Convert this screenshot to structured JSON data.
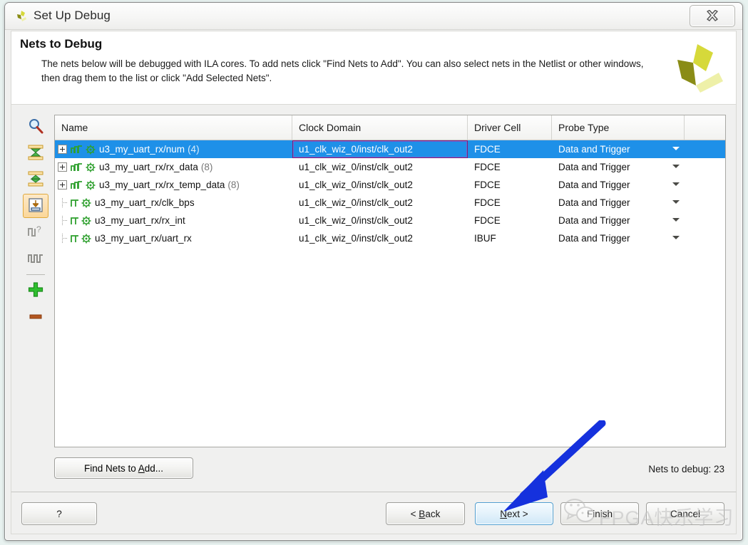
{
  "window": {
    "title": "Set Up Debug",
    "logo_icon": "xilinx-vivado-icon",
    "close_icon": "close-icon"
  },
  "header": {
    "title": "Nets to Debug",
    "description": "The nets below will be debugged with ILA cores. To add nets click \"Find Nets to Add\". You can also select nets in the Netlist or other windows, then drag them to the list or click \"Add Selected Nets\".",
    "brand_logo_icon": "xilinx-logo-icon"
  },
  "toolbar": {
    "items": [
      {
        "icon": "search-icon",
        "name": "find-nets-tool",
        "active": false
      },
      {
        "icon": "collapse-all-icon",
        "name": "collapse-all-tool",
        "active": false
      },
      {
        "icon": "expand-all-icon",
        "name": "expand-all-tool",
        "active": false
      },
      {
        "icon": "import-nets-icon",
        "name": "add-selected-nets-tool",
        "active": true
      },
      {
        "icon": "unknown-clock-icon",
        "name": "nets-unknown-clock-tool",
        "active": false
      },
      {
        "icon": "clock-waveform-icon",
        "name": "clock-domain-tool",
        "active": false
      },
      {
        "icon": "plus-icon",
        "name": "add-net-tool",
        "active": false
      },
      {
        "icon": "minus-icon",
        "name": "remove-net-tool",
        "active": false
      }
    ]
  },
  "table": {
    "columns": [
      {
        "key": "name",
        "label": "Name"
      },
      {
        "key": "clock",
        "label": "Clock Domain"
      },
      {
        "key": "driver",
        "label": "Driver Cell"
      },
      {
        "key": "probe",
        "label": "Probe Type"
      }
    ],
    "rows": [
      {
        "name": "u3_my_uart_rx/num",
        "width": "(4)",
        "clock": "u1_clk_wiz_0/inst/clk_out2",
        "driver": "FDCE",
        "probe": "Data and Trigger",
        "expandable": true,
        "selected": true
      },
      {
        "name": "u3_my_uart_rx/rx_data",
        "width": "(8)",
        "clock": "u1_clk_wiz_0/inst/clk_out2",
        "driver": "FDCE",
        "probe": "Data and Trigger",
        "expandable": true,
        "selected": false
      },
      {
        "name": "u3_my_uart_rx/rx_temp_data",
        "width": "(8)",
        "clock": "u1_clk_wiz_0/inst/clk_out2",
        "driver": "FDCE",
        "probe": "Data and Trigger",
        "expandable": true,
        "selected": false
      },
      {
        "name": "u3_my_uart_rx/clk_bps",
        "width": "",
        "clock": "u1_clk_wiz_0/inst/clk_out2",
        "driver": "FDCE",
        "probe": "Data and Trigger",
        "expandable": false,
        "selected": false
      },
      {
        "name": "u3_my_uart_rx/rx_int",
        "width": "",
        "clock": "u1_clk_wiz_0/inst/clk_out2",
        "driver": "FDCE",
        "probe": "Data and Trigger",
        "expandable": false,
        "selected": false
      },
      {
        "name": "u3_my_uart_rx/uart_rx",
        "width": "",
        "clock": "u1_clk_wiz_0/inst/clk_out2",
        "driver": "IBUF",
        "probe": "Data and Trigger",
        "expandable": false,
        "selected": false
      }
    ]
  },
  "actions": {
    "find_nets": "Find Nets to Add...",
    "nets_to_debug": "Nets to debug: 23"
  },
  "footer": {
    "help": "?",
    "back_pre": "< ",
    "back_key": "B",
    "back_post": "ack",
    "next_key": "N",
    "next_post": "ext >",
    "finish": "Finish",
    "cancel": "Cancel"
  },
  "annotation": {
    "arrow_icon": "pointer-arrow-icon",
    "arrow_color": "#1531dd",
    "target": "next-button"
  },
  "watermark": {
    "text": "FPGA快乐学习",
    "icon": "wechat-icon"
  },
  "colors": {
    "selection": "#1e90e8",
    "accent_active_toolbar": "#e0a93c",
    "focus_cell_border": "#c040c0",
    "next_button_border": "#4f9ed0",
    "brand_yellow": "#d6d93a",
    "brand_olive": "#8a8c16"
  }
}
